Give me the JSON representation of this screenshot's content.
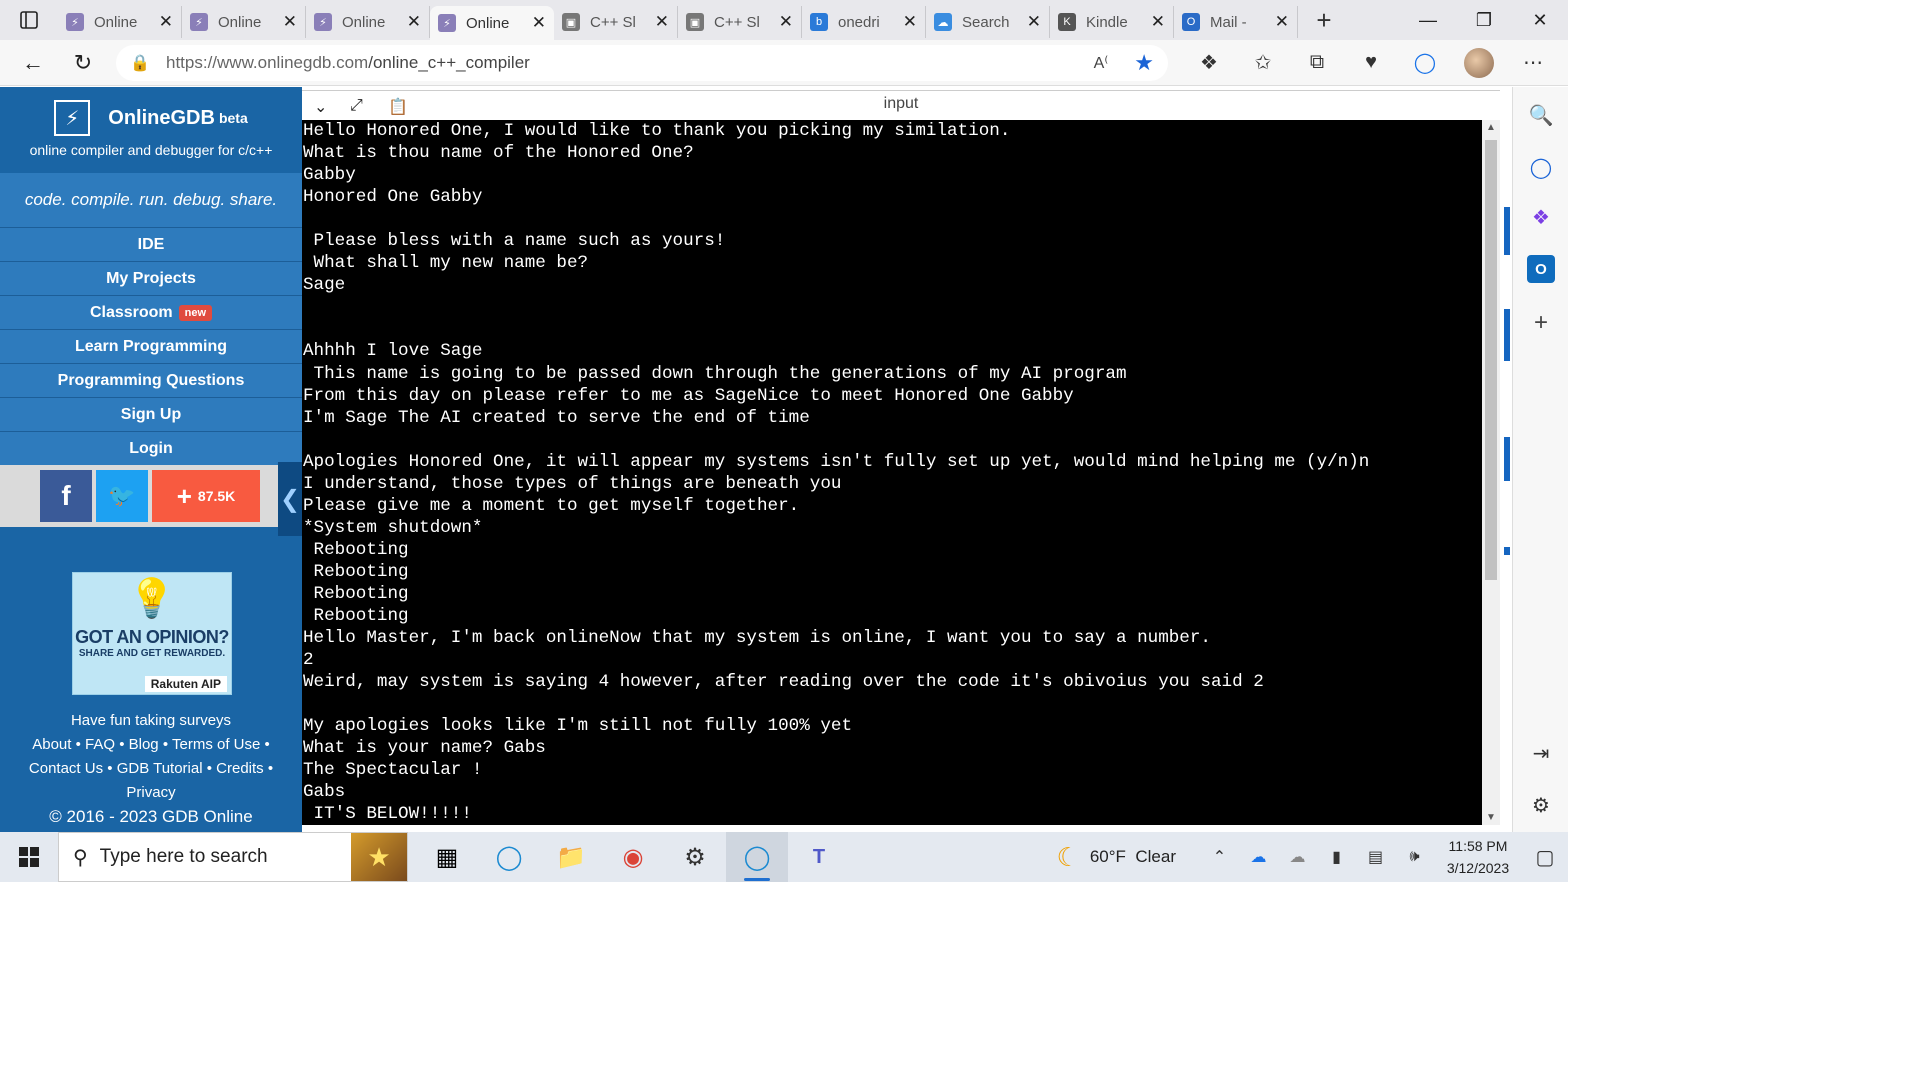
{
  "browser": {
    "tabs": [
      {
        "label": "Online",
        "favicon": "onlinegdb-icon",
        "active": false
      },
      {
        "label": "Online",
        "favicon": "onlinegdb-icon",
        "active": false
      },
      {
        "label": "Online",
        "favicon": "onlinegdb-icon",
        "active": false
      },
      {
        "label": "Online",
        "favicon": "onlinegdb-icon",
        "active": true
      },
      {
        "label": "C++ Sl",
        "favicon": "page-icon",
        "active": false
      },
      {
        "label": "C++ Sl",
        "favicon": "page-icon",
        "active": false
      },
      {
        "label": "onedri",
        "favicon": "bing-icon",
        "active": false
      },
      {
        "label": "Search",
        "favicon": "cloud-icon",
        "active": false
      },
      {
        "label": "Kindle",
        "favicon": "kindle-icon",
        "active": false
      },
      {
        "label": "Mail -",
        "favicon": "outlook-icon",
        "active": false
      }
    ],
    "url_host": "https://www.onlinegdb.com",
    "url_path": "/online_c++_compiler",
    "accent": "#1a63d6"
  },
  "site": {
    "brand": "OnlineGDB",
    "beta": "beta",
    "tagline": "online compiler and debugger for c/c++",
    "slogan": "code. compile. run. debug. share.",
    "nav": [
      "IDE",
      "My Projects",
      "Classroom",
      "Learn Programming",
      "Programming Questions",
      "Sign Up",
      "Login"
    ],
    "new_badge": "new",
    "share_count": "87.5K",
    "ad": {
      "title": "GOT AN OPINION?",
      "subtitle": "SHARE AND GET REWARDED.",
      "brand": "Rakuten AIP"
    },
    "surveys_text": "Have fun taking surveys",
    "footer_links": [
      "About",
      "FAQ",
      "Blog",
      "Terms of Use",
      "Contact Us",
      "GDB Tutorial",
      "Credits",
      "Privacy"
    ],
    "copyright": "© 2016 - 2023 GDB Online",
    "colors": {
      "sidebar": "#1a65a5",
      "nav": "#2e7bbd",
      "facebook": "#3a5a98",
      "twitter": "#1da1f2",
      "share": "#f85a40"
    }
  },
  "panel": {
    "title": "input",
    "lines": [
      "Hello Honored One, I would like to thank you picking my similation.",
      "What is thou name of the Honored One?",
      "Gabby",
      "Honored One Gabby",
      "",
      " Please bless with a name such as yours!",
      " What shall my new name be?",
      "Sage",
      "",
      "",
      "Ahhhh I love Sage",
      " This name is going to be passed down through the generations of my AI program",
      "From this day on please refer to me as SageNice to meet Honored One Gabby",
      "I'm Sage The AI created to serve the end of time",
      "",
      "Apologies Honored One, it will appear my systems isn't fully set up yet, would mind helping me (y/n)n",
      "I understand, those types of things are beneath you",
      "Please give me a moment to get myself together.",
      "*System shutdown*",
      " Rebooting",
      " Rebooting",
      " Rebooting",
      " Rebooting",
      "Hello Master, I'm back onlineNow that my system is online, I want you to say a number.",
      "2",
      "Weird, may system is saying 4 however, after reading over the code it's obivoius you said 2",
      "",
      "My apologies looks like I'm still not fully 100% yet",
      "What is your name? Gabs",
      "The Spectacular !",
      "Gabs",
      " IT'S BELOW!!!!!"
    ]
  },
  "taskbar": {
    "search_placeholder": "Type here to search",
    "weather_temp": "60°F",
    "weather_desc": "Clear",
    "time": "11:58 PM",
    "date": "3/12/2023"
  }
}
